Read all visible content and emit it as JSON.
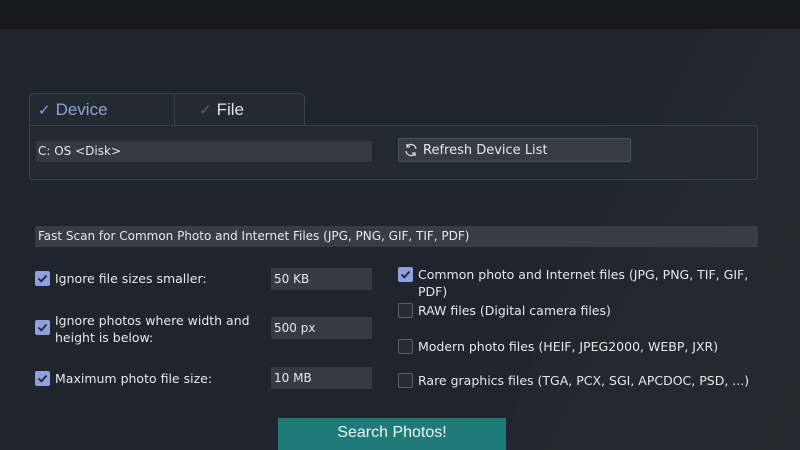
{
  "tabs": {
    "device": "Device",
    "file": "File"
  },
  "device": {
    "selected": "C: OS <Disk>",
    "refresh_label": "Refresh Device List"
  },
  "scan_mode": {
    "selected": "Fast Scan for Common Photo and Internet Files (JPG, PNG, GIF, TIF, PDF)"
  },
  "filters": [
    {
      "label": "Ignore file sizes smaller:",
      "checked": true,
      "value": "50 KB"
    },
    {
      "label": "Ignore photos where width and height is below:",
      "checked": true,
      "value": "500 px"
    },
    {
      "label": "Maximum photo file size:",
      "checked": true,
      "value": "10 MB"
    }
  ],
  "file_types": [
    {
      "label": "Common photo and Internet files (JPG, PNG, TIF, GIF, PDF)",
      "checked": true
    },
    {
      "label": "RAW files (Digital camera files)",
      "checked": false
    },
    {
      "label": "Modern photo files (HEIF, JPEG2000, WEBP, JXR)",
      "checked": false
    },
    {
      "label": "Rare graphics files (TGA, PCX, SGI, APCDOC, PSD, ...)",
      "checked": false
    }
  ],
  "search_label": "Search Photos!",
  "colors": {
    "accent": "#8fa0e0",
    "search_button": "#1f7b78",
    "background": "#1f252c"
  }
}
